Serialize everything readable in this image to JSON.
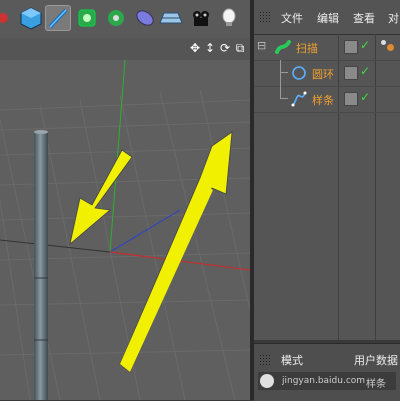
{
  "toolbar": {
    "buttons": [
      {
        "icon": "cube-icon"
      },
      {
        "icon": "pen-icon",
        "active": true
      },
      {
        "icon": "generator-icon"
      },
      {
        "icon": "deformer-icon"
      },
      {
        "icon": "capsule-icon"
      },
      {
        "icon": "floor-icon"
      },
      {
        "icon": "camera-icon"
      },
      {
        "icon": "light-icon"
      }
    ]
  },
  "object_manager": {
    "menu": [
      "文件",
      "编辑",
      "查看",
      "对"
    ],
    "objects": [
      {
        "name": "扫描",
        "icon": "sweep-icon",
        "level": 0
      },
      {
        "name": "圆环",
        "icon": "circle-spline-icon",
        "level": 1
      },
      {
        "name": "样条",
        "icon": "spline-icon",
        "level": 1
      }
    ]
  },
  "attribute_manager": {
    "menu": [
      "模式",
      "用户数据"
    ],
    "watermark_text": "jingyan.baidu.com",
    "field_text": "样条"
  },
  "colors": {
    "arrow": "#f0f000",
    "accent_orange": "#f0a030",
    "check_green": "#3fdc3f",
    "pole": "#6b7a80"
  }
}
